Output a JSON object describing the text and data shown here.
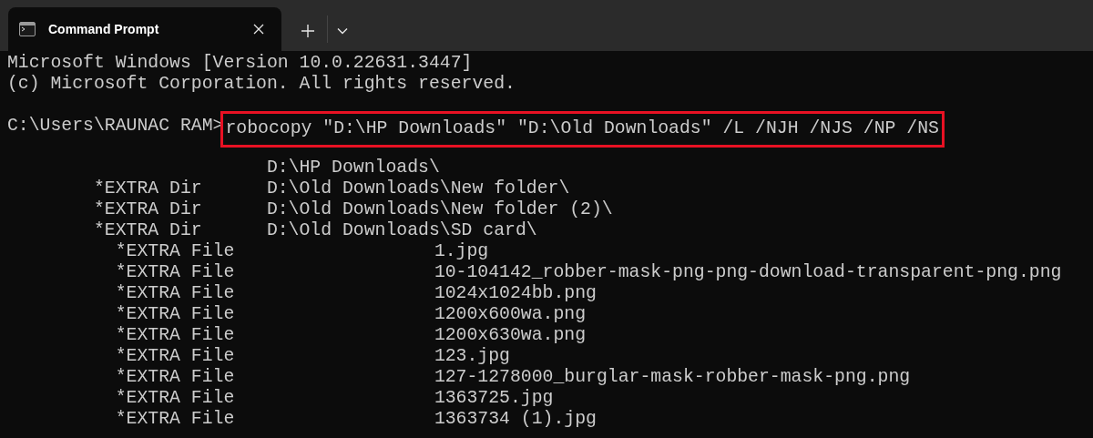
{
  "tab": {
    "title": "Command Prompt",
    "selected": true
  },
  "header_lines": [
    "Microsoft Windows [Version 10.0.22631.3447]",
    "(c) Microsoft Corporation. All rights reserved."
  ],
  "prompt": {
    "path": "C:\\Users\\RAUNAC RAM>",
    "command": "robocopy \"D:\\HP Downloads\" \"D:\\Old Downloads\" /L /NJH /NJS /NP /NS",
    "highlighted": true
  },
  "output": [
    {
      "kind": "root",
      "path": "D:\\HP Downloads\\"
    },
    {
      "kind": "dir",
      "label": "*EXTRA Dir",
      "path": "D:\\Old Downloads\\New folder\\"
    },
    {
      "kind": "dir",
      "label": "*EXTRA Dir",
      "path": "D:\\Old Downloads\\New folder (2)\\"
    },
    {
      "kind": "dir",
      "label": "*EXTRA Dir",
      "path": "D:\\Old Downloads\\SD card\\"
    },
    {
      "kind": "file",
      "label": "*EXTRA File",
      "path": "1.jpg"
    },
    {
      "kind": "file",
      "label": "*EXTRA File",
      "path": "10-104142_robber-mask-png-png-download-transparent-png.png"
    },
    {
      "kind": "file",
      "label": "*EXTRA File",
      "path": "1024x1024bb.png"
    },
    {
      "kind": "file",
      "label": "*EXTRA File",
      "path": "1200x600wa.png"
    },
    {
      "kind": "file",
      "label": "*EXTRA File",
      "path": "1200x630wa.png"
    },
    {
      "kind": "file",
      "label": "*EXTRA File",
      "path": "123.jpg"
    },
    {
      "kind": "file",
      "label": "*EXTRA File",
      "path": "127-1278000_burglar-mask-robber-mask-png.png"
    },
    {
      "kind": "file",
      "label": "*EXTRA File",
      "path": "1363725.jpg"
    },
    {
      "kind": "file",
      "label": "*EXTRA File",
      "path": "1363734 (1).jpg"
    }
  ]
}
